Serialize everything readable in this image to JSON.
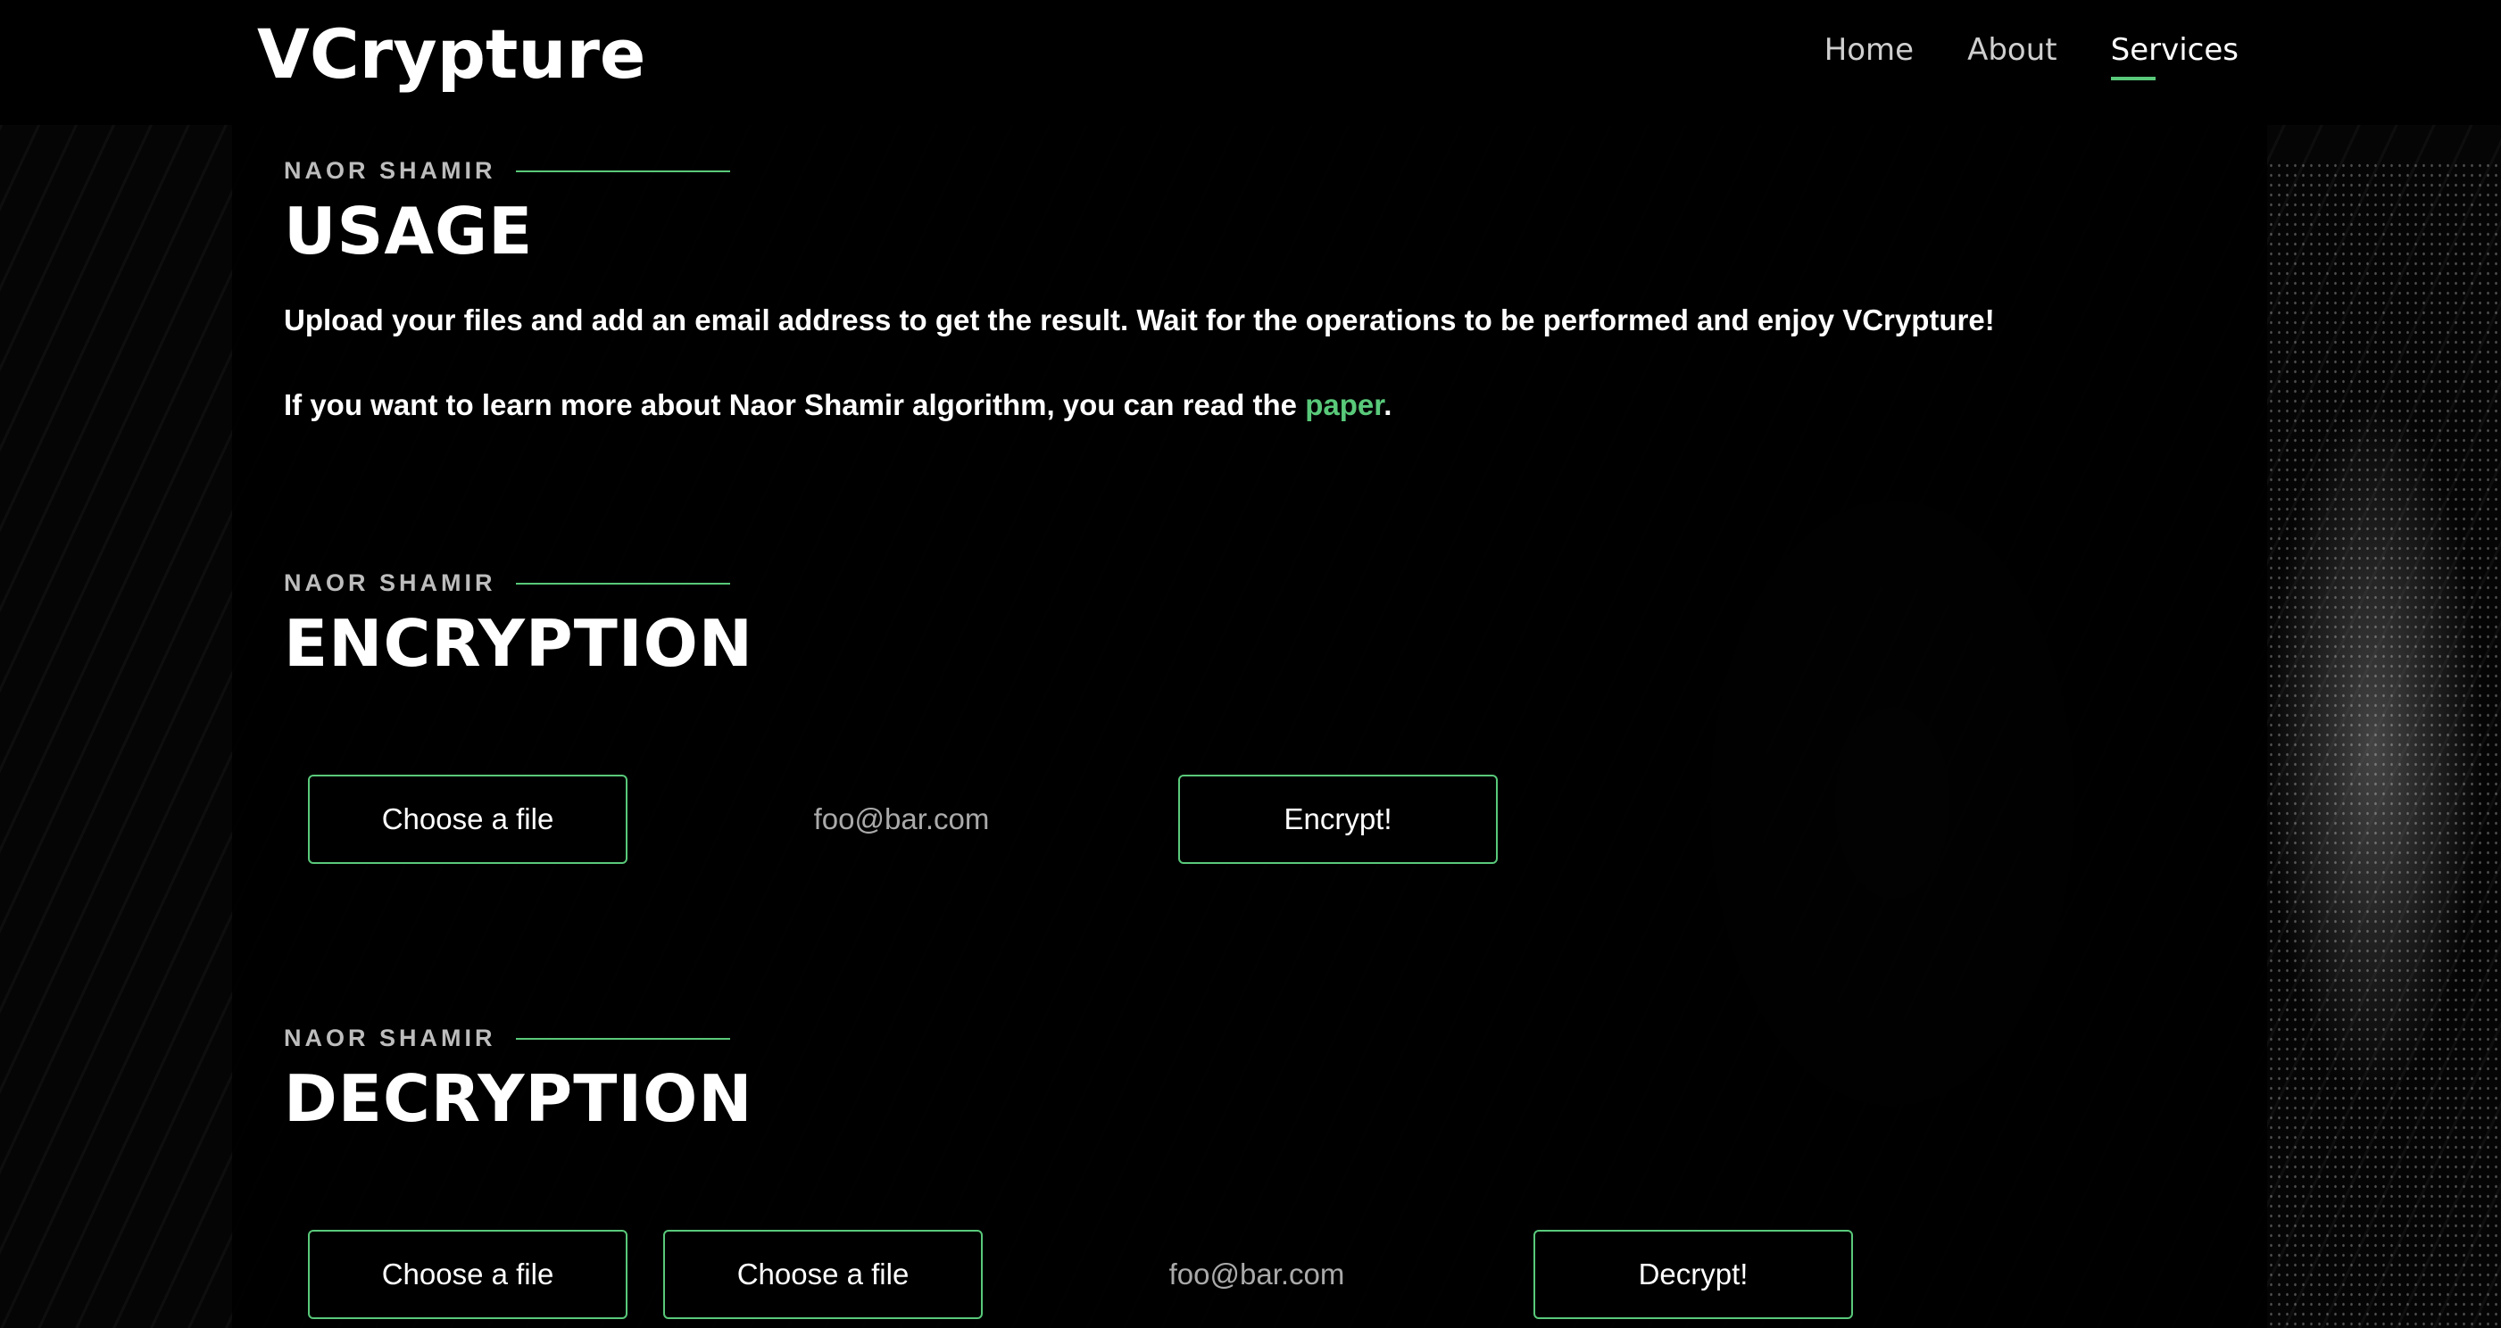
{
  "header": {
    "logo": "VCrypture",
    "nav": [
      {
        "label": "Home"
      },
      {
        "label": "About"
      },
      {
        "label": "Services"
      }
    ],
    "active_nav": "Services"
  },
  "usage": {
    "eyebrow": "NAOR SHAMIR",
    "title": "USAGE",
    "para1": "Upload your files and add an email address to get the result. Wait for the operations to be performed and enjoy VCrypture!",
    "para2_prefix": "If you want to learn more about Naor Shamir algorithm, you can read the ",
    "para2_link": "paper",
    "para2_suffix": "."
  },
  "encryption": {
    "eyebrow": "NAOR SHAMIR",
    "title": "ENCRYPTION",
    "file_button": "Choose a file",
    "email_placeholder": "foo@bar.com",
    "submit": "Encrypt!"
  },
  "decryption": {
    "eyebrow": "NAOR SHAMIR",
    "title": "DECRYPTION",
    "file_button_1": "Choose a file",
    "file_button_2": "Choose a file",
    "email_placeholder": "foo@bar.com",
    "submit": "Decrypt!"
  },
  "colors": {
    "accent": "#59c97a",
    "background": "#000000"
  }
}
